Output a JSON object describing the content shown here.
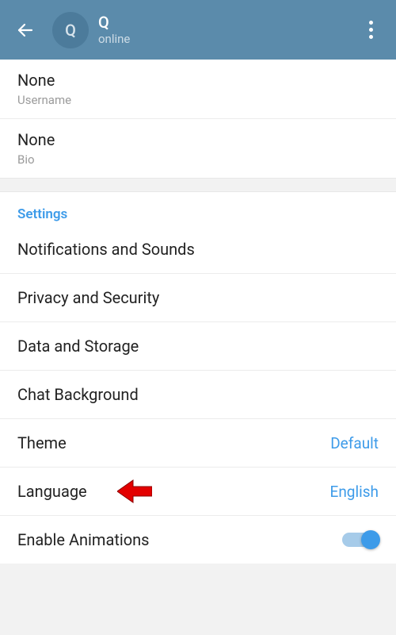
{
  "header": {
    "avatar_letter": "Q",
    "name": "Q",
    "status": "online"
  },
  "profile": {
    "username_value": "None",
    "username_label": "Username",
    "bio_value": "None",
    "bio_label": "Bio"
  },
  "settings": {
    "header": "Settings",
    "items": [
      {
        "label": "Notifications and Sounds"
      },
      {
        "label": "Privacy and Security"
      },
      {
        "label": "Data and Storage"
      },
      {
        "label": "Chat Background"
      },
      {
        "label": "Theme",
        "value": "Default"
      },
      {
        "label": "Language",
        "value": "English"
      },
      {
        "label": "Enable Animations",
        "toggle": true
      }
    ]
  }
}
